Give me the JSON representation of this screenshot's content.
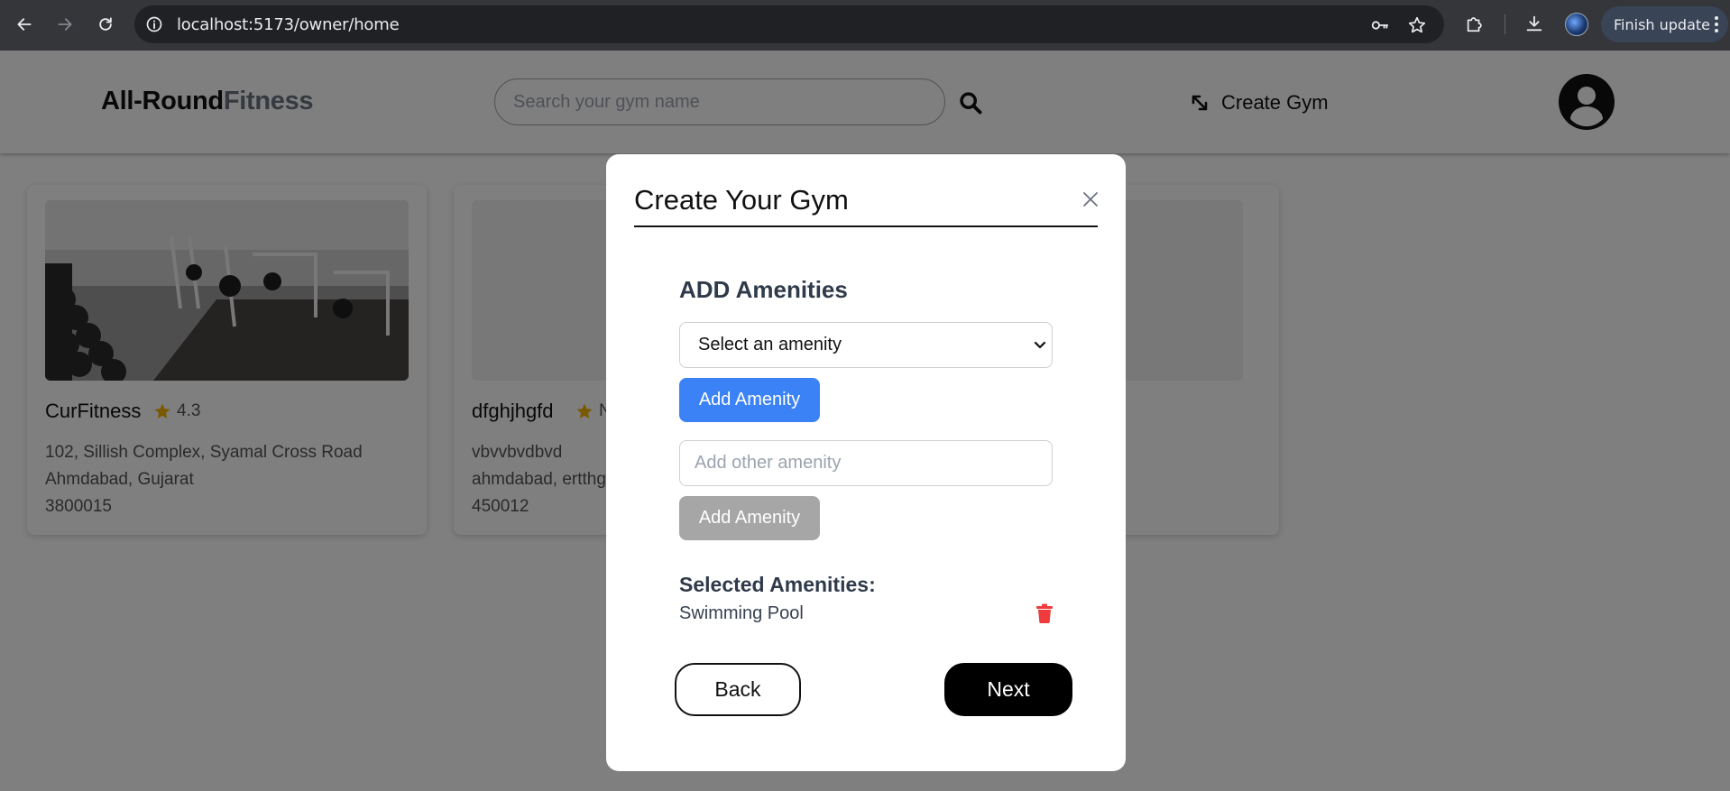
{
  "browser": {
    "url": "localhost:5173/owner/home",
    "finish_update_label": "Finish update"
  },
  "header": {
    "brand_part1": "All-Round",
    "brand_part2": "Fitness",
    "search_placeholder": "Search your gym name",
    "create_gym_label": "Create Gym"
  },
  "cards": [
    {
      "name": "CurFitness",
      "rating": "4.3",
      "address_line1": "102, Sillish Complex, Syamal Cross Road",
      "address_line2": "Ahmdabad, Gujarat",
      "address_line3": "3800015"
    },
    {
      "name": "dfghjhgfd",
      "rating": "N",
      "address_line1": "vbvvbvdbvd",
      "address_line2": "ahmdabad, ertthg",
      "address_line3": "450012"
    }
  ],
  "modal": {
    "title": "Create Your Gym",
    "section_title": "ADD Amenities",
    "select_value": "Select an amenity",
    "add_amenity_label": "Add Amenity",
    "other_placeholder": "Add other amenity",
    "add_other_label": "Add Amenity",
    "selected_title": "Selected Amenities:",
    "selected_amenities": [
      "Swimming Pool"
    ],
    "back_label": "Back",
    "next_label": "Next"
  },
  "colors": {
    "primary_blue": "#3b82f6",
    "disabled_gray": "#a6a6a6",
    "delete_red": "#ef3b3b",
    "star": "#f5b301",
    "chrome_bg": "#35363a"
  },
  "icons": {
    "back": "arrow-left-icon",
    "forward": "arrow-right-icon",
    "reload": "reload-icon",
    "site_info": "info-icon",
    "password": "key-icon",
    "bookmark": "star-icon",
    "extensions": "puzzle-icon",
    "downloads": "download-icon",
    "search": "search-icon",
    "create_gym": "expand-arrows-icon",
    "avatar": "user-circle-icon",
    "close": "close-icon",
    "delete": "trash-icon"
  }
}
